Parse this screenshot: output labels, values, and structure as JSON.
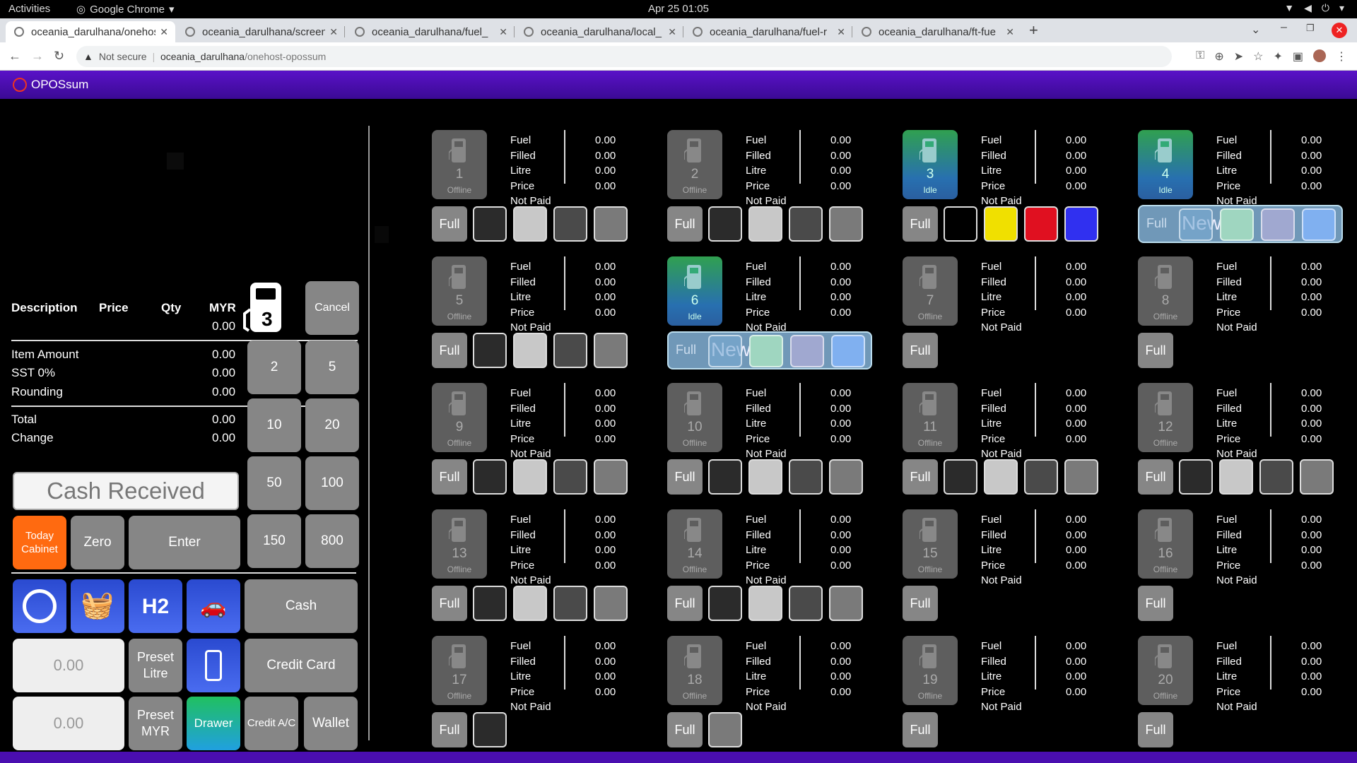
{
  "system": {
    "activities": "Activities",
    "app": "Google Chrome",
    "clock": "Apr 25  01:05"
  },
  "tabs": [
    {
      "title": "oceania_darulhana/onehost-opossum"
    },
    {
      "title": "oceania_darulhana/screen"
    },
    {
      "title": "oceania_darulhana/fuel_"
    },
    {
      "title": "oceania_darulhana/local_"
    },
    {
      "title": "oceania_darulhana/fuel-r"
    },
    {
      "title": "oceania_darulhana/ft-fue"
    }
  ],
  "address": {
    "security": "Not secure",
    "host": "oceania_darulhana",
    "path": "/onehost-opossum"
  },
  "app_title": "OPOSsum",
  "receipt": {
    "headers": {
      "description": "Description",
      "price": "Price",
      "qty": "Qty",
      "currency": "MYR"
    },
    "subtotal": "0.00",
    "lines": [
      {
        "label": "Item Amount",
        "value": "0.00"
      },
      {
        "label": "SST 0%",
        "value": "0.00"
      },
      {
        "label": "Rounding",
        "value": "0.00"
      }
    ],
    "total": {
      "label": "Total",
      "value": "0.00"
    },
    "change": {
      "label": "Change",
      "value": "0.00"
    }
  },
  "selected_pump": "3",
  "keypad": {
    "cancel": "Cancel",
    "amounts": [
      "2",
      "5",
      "10",
      "20",
      "50",
      "100",
      "150",
      "800"
    ]
  },
  "cash_received": "Cash Received",
  "actions": {
    "today_cabinet": "Today Cabinet",
    "zero": "Zero",
    "enter": "Enter",
    "cash": "Cash",
    "credit_card": "Credit Card",
    "preset_litre": "Preset Litre",
    "preset_myr": "Preset MYR",
    "drawer": "Drawer",
    "credit_ac": "Credit A/C",
    "wallet": "Wallet",
    "preset_litre_value": "0.00",
    "preset_myr_value": "0.00",
    "h2_label": "H2"
  },
  "pump_labels": [
    "Fuel",
    "Filled",
    "Litre",
    "Price",
    "Not Paid"
  ],
  "pump_values": [
    "0.00",
    "0.00",
    "0.00",
    "0.00"
  ],
  "full_label": "Full",
  "new_label": "New",
  "pumps": [
    {
      "num": "1",
      "status": "Offline"
    },
    {
      "num": "2",
      "status": "Offline"
    },
    {
      "num": "3",
      "status": "Idle"
    },
    {
      "num": "4",
      "status": "Idle"
    },
    {
      "num": "5",
      "status": "Offline"
    },
    {
      "num": "6",
      "status": "Idle"
    },
    {
      "num": "7",
      "status": "Offline"
    },
    {
      "num": "8",
      "status": "Offline"
    },
    {
      "num": "9",
      "status": "Offline"
    },
    {
      "num": "10",
      "status": "Offline"
    },
    {
      "num": "11",
      "status": "Offline"
    },
    {
      "num": "12",
      "status": "Offline"
    },
    {
      "num": "13",
      "status": "Offline"
    },
    {
      "num": "14",
      "status": "Offline"
    },
    {
      "num": "15",
      "status": "Offline"
    },
    {
      "num": "16",
      "status": "Offline"
    },
    {
      "num": "17",
      "status": "Offline"
    },
    {
      "num": "18",
      "status": "Offline"
    },
    {
      "num": "19",
      "status": "Offline"
    },
    {
      "num": "20",
      "status": "Offline"
    }
  ],
  "colors": {
    "accent": "#4a0eb0",
    "today_cabinet": "#ff6a10",
    "drawer_top": "#20c060",
    "drawer_bottom": "#20a0e0"
  }
}
